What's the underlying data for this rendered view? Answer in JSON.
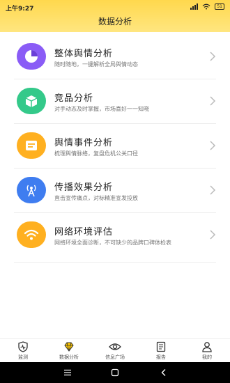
{
  "status_bar": {
    "time": "上午9:27",
    "battery": "51"
  },
  "header": {
    "title": "数据分析"
  },
  "items": [
    {
      "title": "整体舆情分析",
      "subtitle": "随时随地，一键解析全局舆情动态",
      "icon": "pie-chart-icon",
      "color": "#8a5cf6"
    },
    {
      "title": "竞品分析",
      "subtitle": "对手动态及时掌握，市场喜好一一知晓",
      "icon": "box-icon",
      "color": "#34c98a"
    },
    {
      "title": "舆情事件分析",
      "subtitle": "梳理舆情脉络，复盘危机公关口径",
      "icon": "document-icon",
      "color": "#ffb020"
    },
    {
      "title": "传播效果分析",
      "subtitle": "直击宣传痛点，对标精准宣发投放",
      "icon": "broadcast-tower-icon",
      "color": "#3f7df0"
    },
    {
      "title": "网络环境评估",
      "subtitle": "网络环境全面诊断，不可缺少的品牌口碑体检表",
      "icon": "wifi-icon",
      "color": "#ffb020"
    }
  ],
  "tabs": [
    {
      "label": "监测",
      "icon": "monitor-shield-icon"
    },
    {
      "label": "数据分析",
      "icon": "diamond-icon",
      "active": true
    },
    {
      "label": "信息广场",
      "icon": "eye-icon"
    },
    {
      "label": "报告",
      "icon": "report-icon"
    },
    {
      "label": "我的",
      "icon": "user-icon"
    }
  ]
}
